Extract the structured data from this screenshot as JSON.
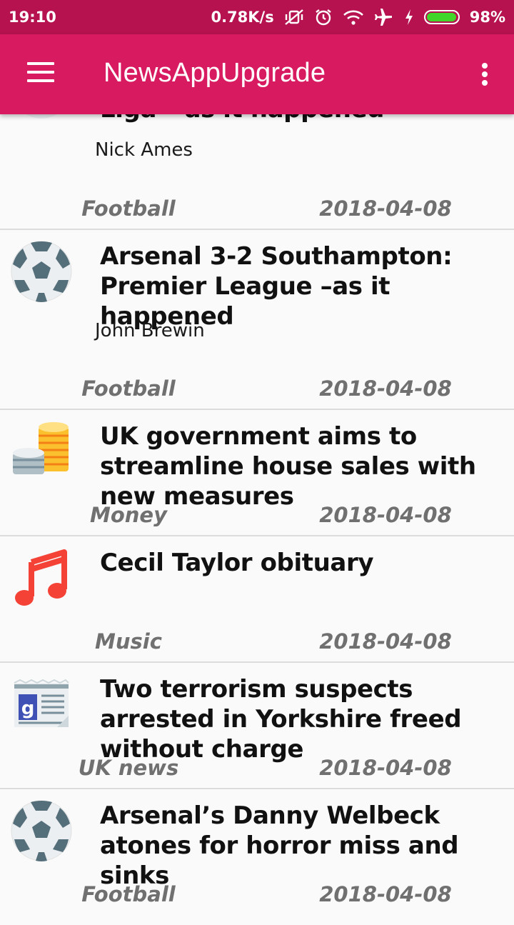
{
  "status_bar": {
    "time": "19:10",
    "speed": "0.78K/s",
    "battery": "98%",
    "battery_level": 0.98,
    "icons": [
      "vibrate-off-icon",
      "alarm-icon",
      "wifi-icon",
      "airplane-icon",
      "charging-icon",
      "battery-icon"
    ]
  },
  "app_bar": {
    "title": "NewsAppUpgrade",
    "menu_icon": "hamburger-menu-icon",
    "overflow_icon": "overflow-menu-icon"
  },
  "articles": [
    {
      "title": "Liga – as it happened",
      "author": "Nick Ames",
      "section": "Football",
      "date": "2018-04-08",
      "icon": "football-icon"
    },
    {
      "title": "Arsenal 3-2  Southampton: Premier League –as it happened",
      "author": "John Brewin",
      "section": "Football",
      "date": "2018-04-08",
      "icon": "football-icon"
    },
    {
      "title": "UK government aims to streamline house sales with new measures",
      "author": "",
      "section": "Money",
      "date": "2018-04-08",
      "icon": "coins-icon"
    },
    {
      "title": "Cecil Taylor obituary",
      "author": "",
      "section": "Music",
      "date": "2018-04-08",
      "icon": "music-note-icon"
    },
    {
      "title": "Two terrorism suspects arrested in Yorkshire freed without charge",
      "author": "",
      "section": "UK news",
      "date": "2018-04-08",
      "icon": "news-icon"
    },
    {
      "title": "Arsenal’s Danny Welbeck atones for horror miss and sinks",
      "author": "",
      "section": "Football",
      "date": "2018-04-08",
      "icon": "football-icon"
    }
  ],
  "colors": {
    "status_bar": "#b5124f",
    "app_bar": "#d81b60",
    "meta_text": "#707070"
  }
}
